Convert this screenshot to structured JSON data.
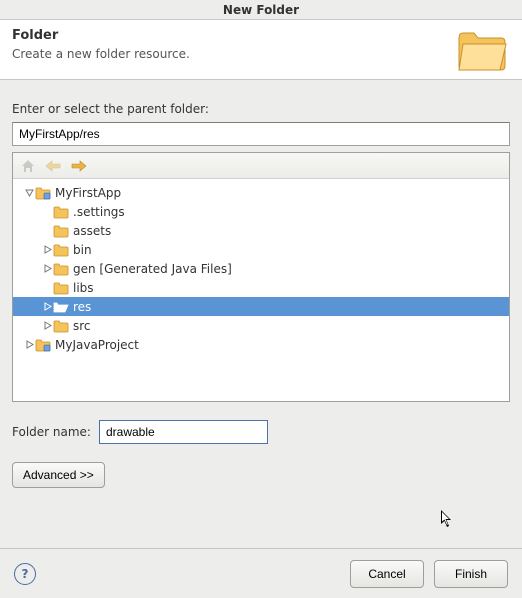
{
  "window": {
    "title": "New Folder"
  },
  "header": {
    "title": "Folder",
    "subtitle": "Create a new folder resource."
  },
  "form": {
    "parent_prompt": "Enter or select the parent folder:",
    "parent_path_value": "MyFirstApp/res",
    "name_label": "Folder name:",
    "name_value": "drawable",
    "advanced_label": "Advanced >>"
  },
  "tree": {
    "nodes": [
      {
        "depth": 0,
        "arrow": "▽",
        "icon": "project-folder-icon",
        "label": "MyFirstApp",
        "selected": false
      },
      {
        "depth": 1,
        "arrow": "",
        "icon": "folder-icon",
        "label": ".settings",
        "selected": false
      },
      {
        "depth": 1,
        "arrow": "",
        "icon": "folder-icon",
        "label": "assets",
        "selected": false
      },
      {
        "depth": 1,
        "arrow": "▷",
        "icon": "folder-icon",
        "label": "bin",
        "selected": false
      },
      {
        "depth": 1,
        "arrow": "▷",
        "icon": "folder-icon",
        "label": "gen [Generated Java Files]",
        "selected": false
      },
      {
        "depth": 1,
        "arrow": "",
        "icon": "folder-icon",
        "label": "libs",
        "selected": false
      },
      {
        "depth": 1,
        "arrow": "▷",
        "icon": "folder-open-icon",
        "label": "res",
        "selected": true
      },
      {
        "depth": 1,
        "arrow": "▷",
        "icon": "folder-icon",
        "label": "src",
        "selected": false
      },
      {
        "depth": 0,
        "arrow": "▷",
        "icon": "project-folder-icon",
        "label": "MyJavaProject",
        "selected": false
      }
    ]
  },
  "buttons": {
    "cancel": "Cancel",
    "finish": "Finish"
  },
  "icons": {
    "home": "home-icon",
    "back": "back-arrow-icon",
    "forward": "forward-arrow-icon",
    "help": "help-icon",
    "cursor": "mouse-cursor-icon",
    "big": "folder-large-icon"
  }
}
